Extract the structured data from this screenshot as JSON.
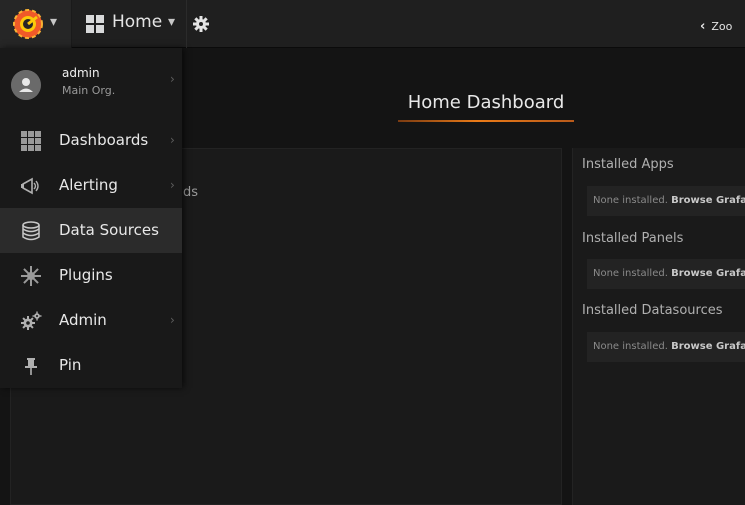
{
  "navbar": {
    "home_label": "Home",
    "zoom_label": "Zoo"
  },
  "icons": {
    "logo": "grafana-logo-icon",
    "dashboards_grid": "grid-icon",
    "settings": "gear-icon",
    "zoom_back": "chevron-left-icon"
  },
  "sidemenu": {
    "profile": {
      "username": "admin",
      "org": "Main Org."
    },
    "items": [
      {
        "label": "Dashboards",
        "icon": "grid-icon",
        "has_submenu": true
      },
      {
        "label": "Alerting",
        "icon": "megaphone-icon",
        "has_submenu": true
      },
      {
        "label": "Data Sources",
        "icon": "database-icon",
        "has_submenu": false,
        "active": true
      },
      {
        "label": "Plugins",
        "icon": "plugin-icon",
        "has_submenu": false
      },
      {
        "label": "Admin",
        "icon": "gears-icon",
        "has_submenu": true
      },
      {
        "label": "Pin",
        "icon": "pin-icon",
        "has_submenu": false
      }
    ]
  },
  "main": {
    "title": "Home Dashboard",
    "left_panel_partial_text": "ds",
    "sections": [
      {
        "heading": "Installed Apps",
        "none_text": "None installed.",
        "browse_link": "Browse Grafa"
      },
      {
        "heading": "Installed Panels",
        "none_text": "None installed.",
        "browse_link": "Browse Grafa"
      },
      {
        "heading": "Installed Datasources",
        "none_text": "None installed.",
        "browse_link": "Browse Grafa"
      }
    ]
  },
  "colors": {
    "background": "#141414",
    "navbar": "#1f1f1f",
    "sidemenu": "#191919",
    "sidemenu_active": "#2b2b2b",
    "accent": "#eb7b18",
    "panel": "#1a1a1a"
  }
}
